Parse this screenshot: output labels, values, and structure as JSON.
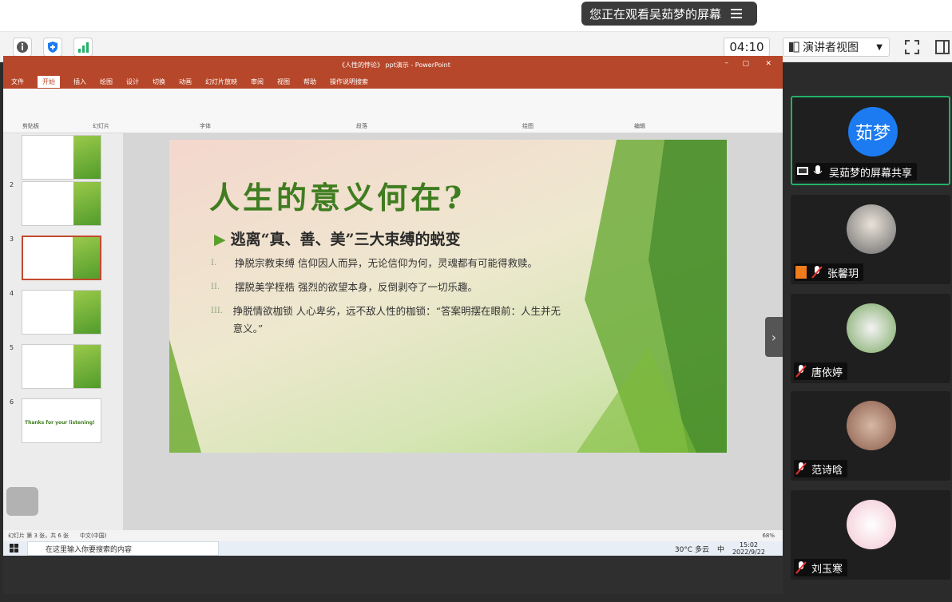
{
  "banner": {
    "text": "您正在观看吴茹梦的屏幕"
  },
  "toolbar": {
    "timer": "04:10",
    "view_label": "演讲者视图"
  },
  "ppt": {
    "title": "《人性的悖论》 ppt演示 - PowerPoint",
    "menu": [
      "文件",
      "开始",
      "插入",
      "绘图",
      "设计",
      "切换",
      "动画",
      "幻灯片放映",
      "审阅",
      "视图",
      "帮助",
      "操作说明搜索"
    ],
    "active_menu": "开始",
    "ribbon_groups": [
      "剪贴板",
      "幻灯片",
      "字体",
      "段落",
      "绘图",
      "编辑"
    ],
    "thumb_numbers": [
      "2",
      "3",
      "4",
      "5",
      "6"
    ],
    "thumb6_text": "Thanks for your listening!",
    "slide": {
      "title": "人生的意义何在?",
      "subtitle": "逃离“真、善、美”三大束缚的蜕变",
      "bullets": [
        {
          "num": "I.",
          "text": "挣脱宗教束缚 信仰因人而异，无论信仰为何，灵魂都有可能得救赎。"
        },
        {
          "num": "II.",
          "text": "摆脱美学桎梏 强烈的欲望本身，反倒剥夺了一切乐趣。"
        },
        {
          "num": "III.",
          "text": "挣脱情欲枷锁 人心卑劣，远不敌人性的枷锁：“答案明摆在眼前：人生并无意义。”"
        }
      ]
    },
    "status": {
      "slide_info": "幻灯片 第 3 张，共 6 张",
      "lang": "中文(中国)",
      "zoom": "68%"
    },
    "taskbar": {
      "search_placeholder": "在这里输入你要搜索的内容",
      "weather": "30°C 多云",
      "time": "15:02",
      "date": "2022/9/22",
      "ime": "中"
    }
  },
  "participants": [
    {
      "name": "吴茹梦的屏幕共享",
      "avatar_text": "茹梦",
      "avatar": "blue"
    },
    {
      "name": "张馨玥",
      "avatar": "photo"
    },
    {
      "name": "唐依婷",
      "avatar": "photo"
    },
    {
      "name": "范诗晗",
      "avatar": "photo"
    },
    {
      "name": "刘玉寒",
      "avatar": "photo"
    }
  ],
  "colors": {
    "ppt_red": "#b7472a",
    "accent_green": "#3f7d20",
    "active_border": "#23b06a",
    "avatar_blue": "#1d7bf1"
  }
}
